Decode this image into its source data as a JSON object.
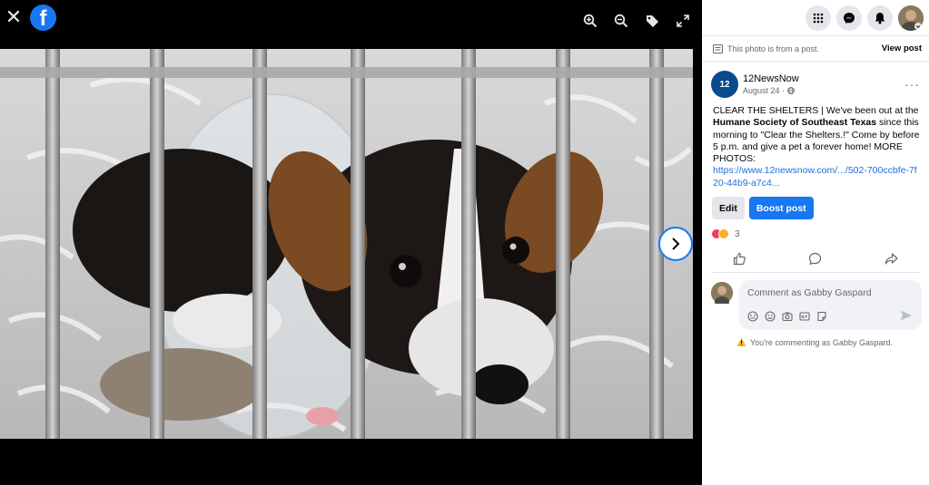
{
  "viewer": {
    "close_glyph": "✕",
    "logo_glyph": "f",
    "next_glyph": "›"
  },
  "panel": {
    "from_post_text": "This photo is from a post.",
    "view_post_label": "View post"
  },
  "post": {
    "page_name": "12NewsNow",
    "page_avatar_text": "12",
    "date": "August 24 · ",
    "more_glyph": "···",
    "text_intro": "CLEAR THE SHELTERS | We've been out at the ",
    "text_org": "Humane Society of Southeast Texas",
    "text_rest": " since this morning to \"Clear the Shelters.!\" Come by before 5 p.m. and give a pet a forever home! MORE PHOTOS:",
    "link_text": "https://www.12newsnow.com/.../502-700ccbfe-7f20-44b9-a7c4...",
    "edit_label": "Edit",
    "boost_label": "Boost post",
    "reaction_count": "3"
  },
  "comment": {
    "placeholder": "Comment as Gabby Gaspard",
    "commenting_as": "You're commenting as Gabby Gaspard."
  },
  "colors": {
    "accent": "#1877f2",
    "link": "#216fdb"
  },
  "icons": [
    "close-icon",
    "facebook-logo",
    "zoom-in-icon",
    "zoom-out-icon",
    "tag-icon",
    "fullscreen-icon",
    "menu-grid-icon",
    "messenger-icon",
    "notifications-icon",
    "post-icon",
    "globe-icon",
    "like-icon",
    "comment-icon",
    "share-icon",
    "avatar-icon",
    "emoji-icon",
    "camera-icon",
    "gif-icon",
    "sticker-icon",
    "send-icon",
    "warning-icon"
  ]
}
